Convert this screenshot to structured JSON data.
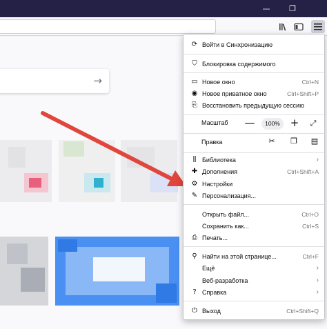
{
  "titlebar": {
    "minimize_icon": "—",
    "restore_icon": "❐"
  },
  "navbar": {
    "library_icon": "library-icon",
    "sidebar_icon": "sidebar-icon",
    "menu_icon": "hamburger-icon"
  },
  "content": {
    "search_arrow": "→"
  },
  "menu": {
    "sync": {
      "label": "Войти в Синхронизацию"
    },
    "content_blocking": {
      "label": "Блокировка содержимого"
    },
    "new_window": {
      "label": "Новое окно",
      "shortcut": "Ctrl+N"
    },
    "private_window": {
      "label": "Новое приватное окно",
      "shortcut": "Ctrl+Shift+P"
    },
    "restore_session": {
      "label": "Восстановить предыдущую сессию"
    },
    "zoom": {
      "label": "Масштаб",
      "minus": "—",
      "value": "100%",
      "plus": "+"
    },
    "edit": {
      "label": "Правка"
    },
    "library": {
      "label": "Библиотека"
    },
    "addons": {
      "label": "Дополнения",
      "shortcut": "Ctrl+Shift+A"
    },
    "settings": {
      "label": "Настройки"
    },
    "customize": {
      "label": "Персонализация..."
    },
    "open_file": {
      "label": "Открыть файл...",
      "shortcut": "Ctrl+O"
    },
    "save_as": {
      "label": "Сохранить как...",
      "shortcut": "Ctrl+S"
    },
    "print": {
      "label": "Печать..."
    },
    "find": {
      "label": "Найти на этой странице...",
      "shortcut": "Ctrl+F"
    },
    "more": {
      "label": "Ещё"
    },
    "web_dev": {
      "label": "Веб-разработка"
    },
    "help": {
      "label": "Справка"
    },
    "quit": {
      "label": "Выход",
      "shortcut": "Ctrl+Shift+Q"
    },
    "submenu_arrow": "›"
  },
  "colors": {
    "titlebar": "#242046",
    "annotation_arrow": "#e0463b",
    "accent_blue": "#4a90f2"
  }
}
